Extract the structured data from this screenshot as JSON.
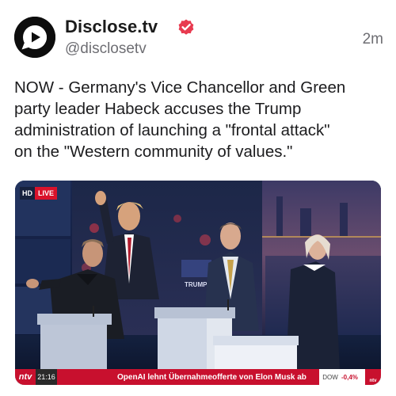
{
  "post": {
    "author_name": "Disclose.tv",
    "handle": "@disclosetv",
    "timestamp": "2m",
    "verified": true,
    "avatar_icon": "play-speech-bubble-icon",
    "verified_icon": "verified-badge-icon",
    "text_lines": [
      "NOW - Germany's Vice Chancellor and Green",
      "party leader Habeck accuses the Trump",
      "administration of launching a \"frontal attack\"",
      "on the \"Western community of values.\""
    ]
  },
  "media": {
    "badge_hd": "HD",
    "badge_live": "LIVE",
    "channel_logo": "ntv",
    "ticker_time": "21:16",
    "ticker_headline": "OpenAI lehnt Übernahmeofferte von Elon Musk ab",
    "index_label": "DOW",
    "index_value": "-0,4%",
    "corner_logo": "ntv",
    "screen_sign": "TRUMP"
  },
  "colors": {
    "verified": "#e83a4f",
    "live_red": "#d9122b",
    "ticker_red": "#c8102e",
    "studio_blue": "#0e1b38"
  }
}
